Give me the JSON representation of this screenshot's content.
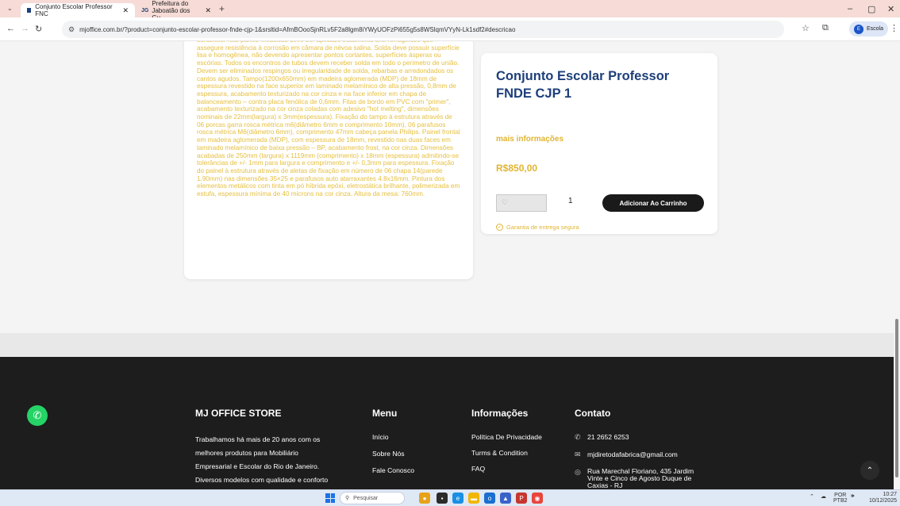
{
  "browser": {
    "tabs": [
      {
        "label": "Conjunto Escolar Professor FNC",
        "active": true
      },
      {
        "label": "Prefeitura do Jaboatão dos Gu",
        "active": false
      }
    ],
    "url": "mjoffice.com.br/?product=conjunto-escolar-professor-fnde-cjp-1&srsltid=AfmBOooSjnRLv5F2a8lgm8iYWyUOFzPi655g5s8WSlqmVYyN-Lk1sdf2#descricao",
    "profile_label": "Escola",
    "profile_initial": "E"
  },
  "description": {
    "text": "cortantes. Nas partes metálicas deve ser aplicado tratamento anti-ferruginoso que assegure resistência à corrosão em câmara de névoa salina. Solda deve possuir superfície lisa e homogênea, não devendo apresentar pontos cortantes, superfícies ásperas ou escórias. Todos os encontros de tubos devem receber solda em todo o perímetro de união. Devem ser eliminados respingos ou irregularidade de solda, rebarbas e arredondados os cantos agudos. Tampo(1200x650mm) em madeira aglomerada (MDP) de 18mm de espessura revestido na face superior em laminado melamínico de alta pressão, 0,8mm de espessura, acabamento texturizado na cor cinza e na face inferior em chapa de balanceamento – contra placa fenólica de 0,6mm. Fitas de bordo em PVC com \"primer\", acabamento texturizado na cor cinza coladas com adesivo \"hot melting\", dimensões nominais de 22mm(largura) x 3mm(espessura). Fixação do tampo à estrutura através de 06 porcas garra rosca métrica m6(diâmetro 6mm e comprimento 10mm), 06 parafusos rosca métrica M6(diâmetro 6mm), comprimento 47mm cabeça panela Philips. Painel frontal em madeira aglomerada (MDP), com espessura de 18mm, revestido nas duas faces em laminado melamínico de baixa pressão – BP, acabamento frost, na cor cinza. Dimensões acabadas de 250mm (largura) x 1119mm (comprimento) x 18mm (espessura) admitindo-se tolerâncias de +/- 1mm para largura e comprimento e +/- 0,3mm para espessura. Fixação do painel à estrutura através de aletas de fixação em número de 06 chapa 14(parede 1,90mm) nas dimensões 35×25 e parafusos auto atarraxantes 4.8x16mm. Pintura dos elementos metálicos com tinta em pó híbrida epóxi, eletrostática brilhante, polimerizada em estufa, espessura mínima de 40 microns na cor cinza. Altura da mesa: 760mm."
  },
  "product": {
    "title": "Conjunto Escolar Professor FNDE CJP 1",
    "more_info": "mais informações",
    "price": "R$850,00",
    "quantity": "1",
    "add_to_cart": "Adicionar Ao Carrinho",
    "guarantee": "Garantia de entrega segura"
  },
  "footer": {
    "store": {
      "title": "MJ OFFICE STORE",
      "about": "Trabalhamos há mais de 20 anos com os melhores produtos para Mobiliário Empresarial e Escolar do Rio de Janeiro. Diversos modelos com qualidade e conforto que você"
    },
    "menu": {
      "title": "Menu",
      "items": [
        "Início",
        "Sobre Nós",
        "Fale Conosco"
      ]
    },
    "info": {
      "title": "Informações",
      "items": [
        "Política De Privacidade",
        "Turms & Condition",
        "FAQ"
      ]
    },
    "contact": {
      "title": "Contato",
      "phone": "21 2652 6253",
      "email": "mjdiretodafabrica@gmail.com",
      "address": "Rua Marechal Floriano, 435 Jardim Vinte e Cinco de Agosto Duque de Caxias - RJ"
    }
  },
  "taskbar": {
    "search_placeholder": "Pesquisar",
    "lang": "POR",
    "layout": "PTB2",
    "time": "10:27",
    "date": "10/12/2025"
  }
}
